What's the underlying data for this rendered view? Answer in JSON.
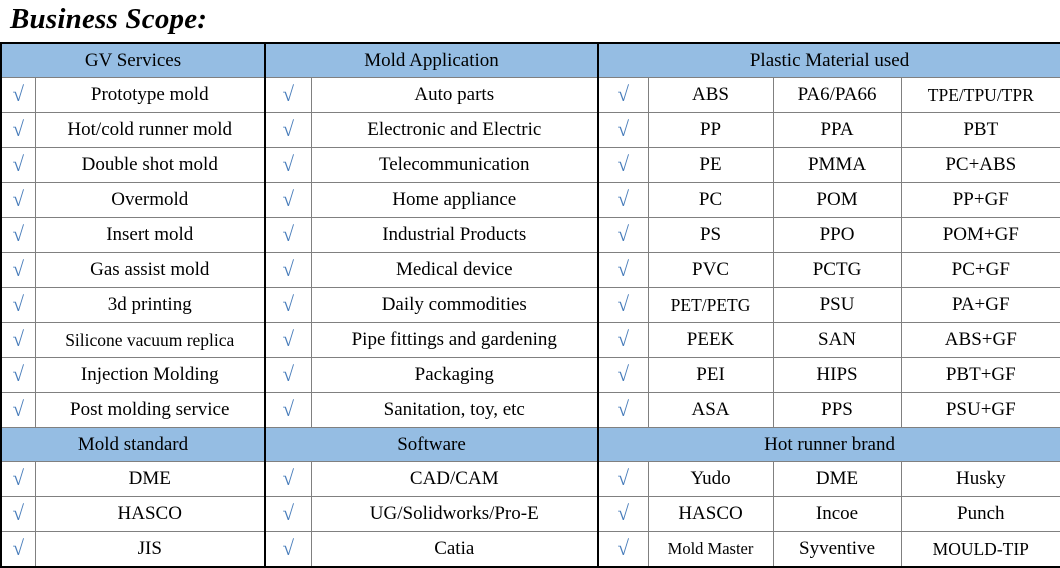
{
  "page": {
    "title": "Business Scope:"
  },
  "colors": {
    "header_background": "#95bde3",
    "check_mark": "#4a7ebb",
    "border": "#808080",
    "outer_border": "#000000",
    "text": "#000000"
  },
  "check_glyph": "√",
  "table": {
    "section_a": {
      "headers": [
        {
          "label": "GV Services",
          "colspan": 2
        },
        {
          "label": "Mold Application",
          "colspan": 2
        },
        {
          "label": "Plastic Material used",
          "colspan": 4
        }
      ],
      "rows": [
        {
          "gv_check": "√",
          "gv": "Prototype mold",
          "app_check": "√",
          "app": "Auto parts",
          "mat_check": "√",
          "mat1": "ABS",
          "mat2": "PA6/PA66",
          "mat3": "TPE/TPU/TPR"
        },
        {
          "gv_check": "√",
          "gv": "Hot/cold runner mold",
          "app_check": "√",
          "app": "Electronic and Electric",
          "mat_check": "√",
          "mat1": "PP",
          "mat2": "PPA",
          "mat3": "PBT"
        },
        {
          "gv_check": "√",
          "gv": "Double shot mold",
          "app_check": "√",
          "app": "Telecommunication",
          "mat_check": "√",
          "mat1": "PE",
          "mat2": "PMMA",
          "mat3": "PC+ABS"
        },
        {
          "gv_check": "√",
          "gv": "Overmold",
          "app_check": "√",
          "app": "Home appliance",
          "mat_check": "√",
          "mat1": "PC",
          "mat2": "POM",
          "mat3": "PP+GF"
        },
        {
          "gv_check": "√",
          "gv": "Insert mold",
          "app_check": "√",
          "app": "Industrial Products",
          "mat_check": "√",
          "mat1": "PS",
          "mat2": "PPO",
          "mat3": "POM+GF"
        },
        {
          "gv_check": "√",
          "gv": "Gas assist mold",
          "app_check": "√",
          "app": "Medical device",
          "mat_check": "√",
          "mat1": "PVC",
          "mat2": "PCTG",
          "mat3": "PC+GF"
        },
        {
          "gv_check": "√",
          "gv": "3d printing",
          "app_check": "√",
          "app": "Daily commodities",
          "mat_check": "√",
          "mat1": "PET/PETG",
          "mat2": "PSU",
          "mat3": "PA+GF"
        },
        {
          "gv_check": "√",
          "gv": "Silicone vacuum replica",
          "app_check": "√",
          "app": "Pipe fittings and gardening",
          "mat_check": "√",
          "mat1": "PEEK",
          "mat2": "SAN",
          "mat3": "ABS+GF"
        },
        {
          "gv_check": "√",
          "gv": "Injection Molding",
          "app_check": "√",
          "app": "Packaging",
          "mat_check": "√",
          "mat1": "PEI",
          "mat2": "HIPS",
          "mat3": "PBT+GF"
        },
        {
          "gv_check": "√",
          "gv": "Post molding service",
          "app_check": "√",
          "app": "Sanitation, toy, etc",
          "mat_check": "√",
          "mat1": "ASA",
          "mat2": "PPS",
          "mat3": "PSU+GF"
        }
      ]
    },
    "section_b": {
      "headers": [
        {
          "label": "Mold standard",
          "colspan": 2
        },
        {
          "label": "Software",
          "colspan": 2
        },
        {
          "label": "Hot runner brand",
          "colspan": 4
        }
      ],
      "rows": [
        {
          "std_check": "√",
          "std": "DME",
          "sw_check": "√",
          "sw": "CAD/CAM",
          "hr_check": "√",
          "hr1": "Yudo",
          "hr2": "DME",
          "hr3": "Husky"
        },
        {
          "std_check": "√",
          "std": "HASCO",
          "sw_check": "√",
          "sw": "UG/Solidworks/Pro-E",
          "hr_check": "√",
          "hr1": "HASCO",
          "hr2": "Incoe",
          "hr3": "Punch"
        },
        {
          "std_check": "√",
          "std": "JIS",
          "sw_check": "√",
          "sw": "Catia",
          "hr_check": "√",
          "hr1": "Mold Master",
          "hr2": "Syventive",
          "hr3": "MOULD-TIP"
        }
      ]
    }
  }
}
